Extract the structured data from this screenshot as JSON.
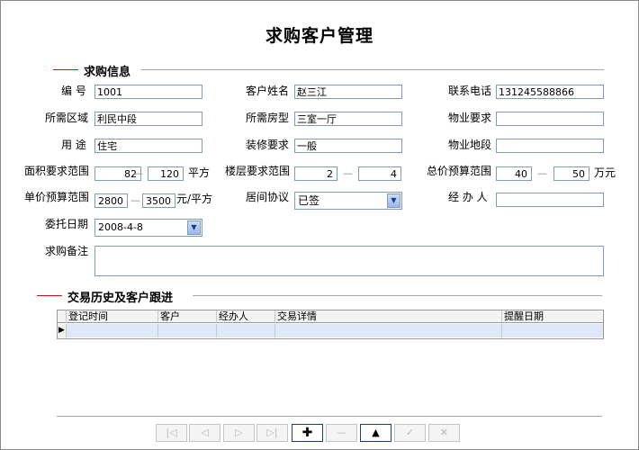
{
  "page_title": "求购客户管理",
  "section_info": "求购信息",
  "section_history": "交易历史及客户跟进",
  "fields": {
    "id": {
      "label": "编  号",
      "value": "1001"
    },
    "customer_name": {
      "label": "客户姓名",
      "value": "赵三江"
    },
    "phone": {
      "label": "联系电话",
      "value": "131245588866"
    },
    "area_region": {
      "label": "所需区域",
      "value": "利民中段"
    },
    "room_type": {
      "label": "所需房型",
      "value": "三室一厅"
    },
    "property_req": {
      "label": "物业要求",
      "value": ""
    },
    "usage": {
      "label": "用  途",
      "value": "住宅"
    },
    "decoration": {
      "label": "装修要求",
      "value": "一般"
    },
    "property_location": {
      "label": "物业地段",
      "value": ""
    },
    "area_range": {
      "label": "面积要求范围",
      "min": "82",
      "max": "120",
      "unit": "平方"
    },
    "floor_range": {
      "label": "楼层要求范围",
      "min": "2",
      "max": "4"
    },
    "total_budget": {
      "label": "总价预算范围",
      "min": "40",
      "max": "50",
      "unit": "万元"
    },
    "unit_budget": {
      "label": "单价预算范围",
      "min": "2800",
      "max": "3500",
      "unit": "元/平方"
    },
    "agreement": {
      "label": "居间协议",
      "value": "已签"
    },
    "agent": {
      "label": "经 办 人",
      "value": ""
    },
    "entrust_date": {
      "label": "委托日期",
      "value": "2008-4-8"
    },
    "remarks": {
      "label": "求购备注",
      "value": ""
    }
  },
  "range_sep": "—",
  "grid": {
    "columns": [
      "登记时间",
      "客户",
      "经办人",
      "交易详情",
      "提醒日期"
    ]
  },
  "icons": {
    "nav": [
      "first-icon",
      "prev-icon",
      "next-icon",
      "last-icon",
      "add-icon",
      "delete-icon",
      "edit-icon",
      "post-icon",
      "cancel-icon"
    ]
  }
}
